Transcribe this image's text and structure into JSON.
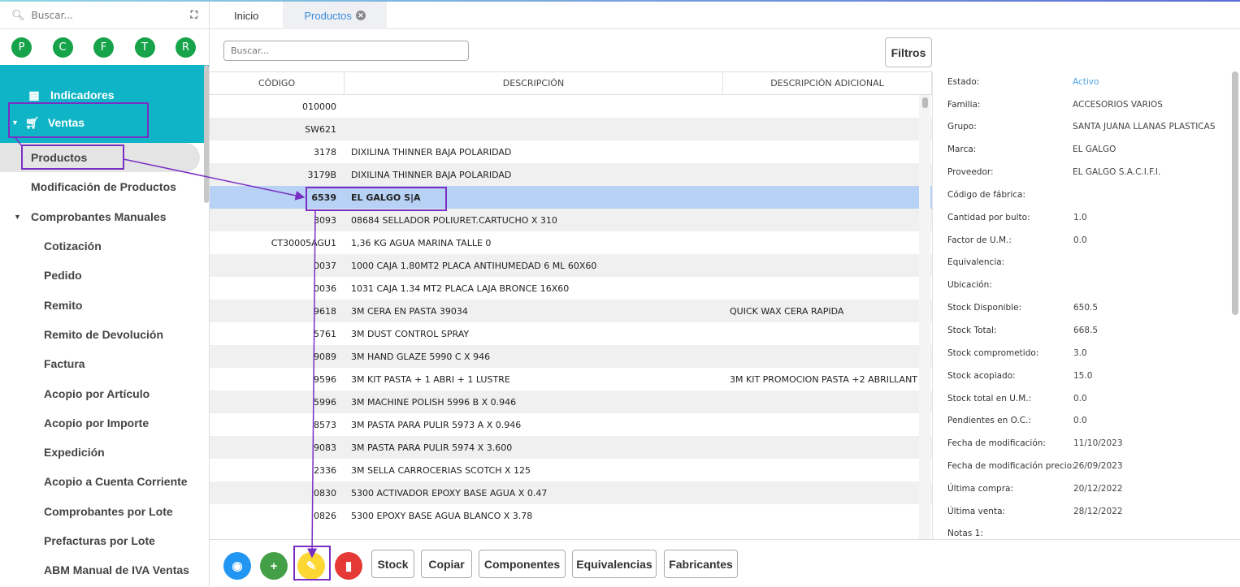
{
  "sidebar": {
    "search_placeholder": "Buscar...",
    "shortcuts": [
      "P",
      "C",
      "F",
      "T",
      "R"
    ],
    "indicadores": "Indicadores",
    "ventas": "Ventas",
    "items": [
      {
        "label": "Productos",
        "level": 1,
        "active": true
      },
      {
        "label": "Modificación de Productos",
        "level": 1
      },
      {
        "label": "Comprobantes Manuales",
        "level": 1,
        "expanded": true
      },
      {
        "label": "Cotización",
        "level": 2
      },
      {
        "label": "Pedido",
        "level": 2
      },
      {
        "label": "Remito",
        "level": 2
      },
      {
        "label": "Remito de Devolución",
        "level": 2
      },
      {
        "label": "Factura",
        "level": 2
      },
      {
        "label": "Acopio por Artículo",
        "level": 2
      },
      {
        "label": "Acopio por Importe",
        "level": 2
      },
      {
        "label": "Expedición",
        "level": 2
      },
      {
        "label": "Acopio a Cuenta Corriente",
        "level": 2
      },
      {
        "label": "Comprobantes por Lote",
        "level": 2
      },
      {
        "label": "Prefacturas por Lote",
        "level": 2
      },
      {
        "label": "ABM Manual de IVA Ventas",
        "level": 2
      }
    ]
  },
  "tabs": [
    {
      "label": "Inicio",
      "active": false
    },
    {
      "label": "Productos",
      "active": true
    }
  ],
  "search": {
    "placeholder": "Buscar..."
  },
  "filtros_label": "Filtros",
  "table": {
    "headers": [
      "CÓDIGO",
      "DESCRIPCIÓN",
      "DESCRIPCIÓN ADICIONAL"
    ],
    "rows": [
      {
        "code": "010000",
        "desc": "",
        "extra": ""
      },
      {
        "code": "SW621",
        "desc": "",
        "extra": ""
      },
      {
        "code": "3178",
        "desc": "DIXILINA THINNER BAJA POLARIDAD",
        "extra": ""
      },
      {
        "code": "3179B",
        "desc": "DIXILINA THINNER BAJA POLARIDAD",
        "extra": ""
      },
      {
        "code": "6539",
        "desc": "EL GALGO S|A",
        "extra": "",
        "selected": true
      },
      {
        "code": "3093",
        "desc": "08684 SELLADOR POLIURET.CARTUCHO X 310",
        "extra": ""
      },
      {
        "code": "CT30005AGU1",
        "desc": "1,36 KG AGUA MARINA TALLE 0",
        "extra": ""
      },
      {
        "code": "0037",
        "desc": "1000 CAJA 1.80MT2 PLACA ANTIHUMEDAD 6 ML 60X60",
        "extra": ""
      },
      {
        "code": "0036",
        "desc": "1031 CAJA 1.34 MT2 PLACA LAJA BRONCE 16X60",
        "extra": ""
      },
      {
        "code": "9618",
        "desc": "3M CERA EN PASTA 39034",
        "extra": "QUICK WAX CERA RAPIDA"
      },
      {
        "code": "5761",
        "desc": "3M DUST CONTROL SPRAY",
        "extra": ""
      },
      {
        "code": "9089",
        "desc": "3M HAND GLAZE 5990 C X 946",
        "extra": ""
      },
      {
        "code": "9596",
        "desc": "3M KIT PASTA + 1 ABRI + 1 LUSTRE",
        "extra": "3M KIT PROMOCION PASTA +2 ABRILLANT"
      },
      {
        "code": "5996",
        "desc": "3M MACHINE POLISH 5996 B X 0.946",
        "extra": ""
      },
      {
        "code": "8573",
        "desc": "3M PASTA PARA PULIR 5973 A X 0.946",
        "extra": ""
      },
      {
        "code": "9083",
        "desc": "3M PASTA PARA PULIR 5974 X 3.600",
        "extra": ""
      },
      {
        "code": "2336",
        "desc": "3M SELLA CARROCERIAS SCOTCH X 125",
        "extra": ""
      },
      {
        "code": "0830",
        "desc": "5300 ACTIVADOR EPOXY BASE AGUA X 0.47",
        "extra": ""
      },
      {
        "code": "0826",
        "desc": "5300 EPOXY BASE AGUA BLANCO X 3.78",
        "extra": ""
      }
    ]
  },
  "details": [
    {
      "label": "Estado:",
      "value": "Activo",
      "link": true
    },
    {
      "label": "Familia:",
      "value": "ACCESORIOS VARIOS"
    },
    {
      "label": "Grupo:",
      "value": "SANTA JUANA LLANAS PLASTICAS"
    },
    {
      "label": "Marca:",
      "value": "EL GALGO"
    },
    {
      "label": "Proveedor:",
      "value": "EL GALGO S.A.C.I.F.I."
    },
    {
      "label": "Código de fábrica:",
      "value": ""
    },
    {
      "label": "Cantidad por bulto:",
      "value": "1.0"
    },
    {
      "label": "Factor de U.M.:",
      "value": "0.0"
    },
    {
      "label": "Equivalencia:",
      "value": ""
    },
    {
      "label": "Ubicación:",
      "value": ""
    },
    {
      "label": "Stock Disponible:",
      "value": "650.5"
    },
    {
      "label": "Stock Total:",
      "value": "668.5"
    },
    {
      "label": "Stock comprometido:",
      "value": "3.0"
    },
    {
      "label": "Stock acopiado:",
      "value": "15.0"
    },
    {
      "label": "Stock total en U.M.:",
      "value": "0.0"
    },
    {
      "label": "Pendientes en O.C.:",
      "value": "0.0"
    },
    {
      "label": "Fecha de modificación:",
      "value": "11/10/2023"
    },
    {
      "label": "Fecha de modificación precio:",
      "value": "26/09/2023"
    },
    {
      "label": "Última compra:",
      "value": "20/12/2022"
    },
    {
      "label": "Última venta:",
      "value": "28/12/2022"
    },
    {
      "label": "Notas 1:",
      "value": ""
    }
  ],
  "toolbar": {
    "view_icon": "eye-icon",
    "add_icon": "plus-icon",
    "edit_icon": "pencil-icon",
    "delete_icon": "trash-icon",
    "buttons": [
      "Stock",
      "Copiar",
      "Componentes",
      "Equivalencias",
      "Fabricantes"
    ]
  },
  "colors": {
    "menu_teal": "#0fb4c6",
    "shortcut_green": "#16a34a",
    "selected_row": "#b8d2f5",
    "annotation": "#7a2fc4",
    "view_btn": "#2196f3",
    "add_btn": "#43a047",
    "edit_btn": "#fdd835",
    "delete_btn": "#e53935"
  }
}
